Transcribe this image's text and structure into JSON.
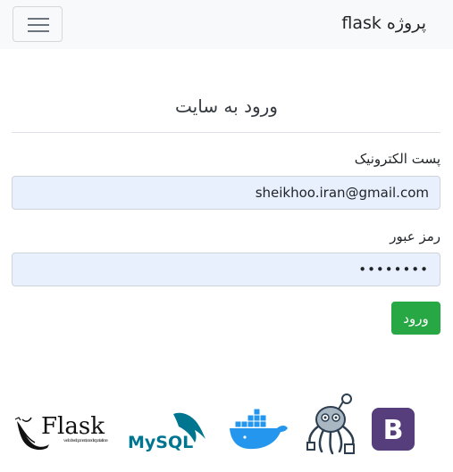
{
  "navbar": {
    "brand": "پروژه flask",
    "toggle_icon": "hamburger-menu-icon"
  },
  "form": {
    "title": "ورود به سایت",
    "email_label": "پست الکترونیک",
    "email_value": "sheikhoo.iran@gmail.com",
    "password_label": "رمز عبور",
    "password_value": "password",
    "submit_label": "ورود"
  },
  "footer_logos": {
    "flask_name": "Flask",
    "flask_tagline": "web development, one drop at a time",
    "mysql_name": "MySQL",
    "bootstrap_letter": "B"
  },
  "colors": {
    "navbar_bg": "#f8f9fa",
    "input_bg": "#e8f0fe",
    "submit_bg": "#28a745",
    "mysql_blue": "#00758f",
    "mysql_orange": "#f29111",
    "docker_blue": "#2496ed",
    "bootstrap_purple": "#563d7c"
  }
}
